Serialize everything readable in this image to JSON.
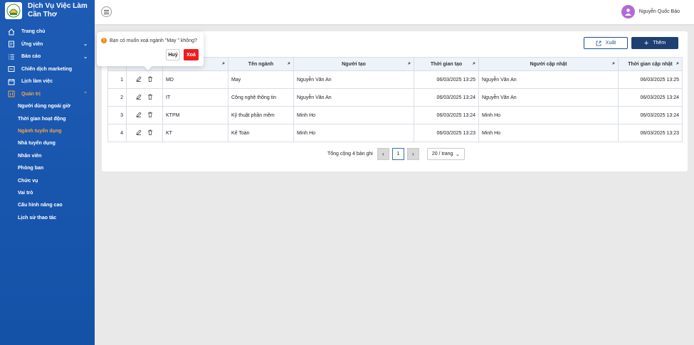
{
  "brand": {
    "title_line1": "Dịch Vụ Việc Làm",
    "title_line2": "Cần Thơ"
  },
  "sidebar": {
    "items": [
      {
        "label": "Trang chủ",
        "icon": "home-icon"
      },
      {
        "label": "Ứng viên",
        "icon": "candidate-icon",
        "expandable": true
      },
      {
        "label": "Báo cáo",
        "icon": "list-icon",
        "expandable": true
      },
      {
        "label": "Chiến dịch marketing",
        "icon": "campaign-icon"
      },
      {
        "label": "Lịch làm việc",
        "icon": "calendar-icon"
      },
      {
        "label": "Quản trị",
        "icon": "admin-icon",
        "expandable": true,
        "expanded": true
      }
    ],
    "sub_items": [
      {
        "label": "Người dùng ngoài giờ"
      },
      {
        "label": "Thời gian hoạt động"
      },
      {
        "label": "Ngành tuyển dụng",
        "active": true
      },
      {
        "label": "Nhà tuyển dụng"
      },
      {
        "label": "Nhân viên"
      },
      {
        "label": "Phòng ban"
      },
      {
        "label": "Chức vụ"
      },
      {
        "label": "Vai trò"
      },
      {
        "label": "Cấu hình nâng cao"
      },
      {
        "label": "Lịch sử thao tác"
      }
    ]
  },
  "header": {
    "user_name": "Nguyễn Quốc Bảo"
  },
  "toolbar": {
    "export_label": "Xuất",
    "add_label": "Thêm"
  },
  "table": {
    "columns": [
      "",
      "",
      "",
      "Tên ngành",
      "Người tạo",
      "Thời gian tạo",
      "Người cập nhật",
      "Thời gian cập nhật"
    ],
    "rows": [
      {
        "stt": "1",
        "code": "MD",
        "name": "May",
        "creator": "Nguyễn Văn An",
        "created": "06/03/2025 13:25",
        "updater": "Nguyễn Văn An",
        "updated": "06/03/2025 13:25"
      },
      {
        "stt": "2",
        "code": "IT",
        "name": "Công nghệ thông tin",
        "creator": "Nguyễn Văn An",
        "created": "06/03/2025 13:24",
        "updater": "Nguyễn Văn An",
        "updated": "06/03/2025 13:24"
      },
      {
        "stt": "3",
        "code": "KTPM",
        "name": "Kỹ thuật phần mềm",
        "creator": "Minh Ho",
        "created": "06/03/2025 13:24",
        "updater": "Minh Ho",
        "updated": "06/03/2025 13:24"
      },
      {
        "stt": "4",
        "code": "KT",
        "name": "Kế Toán",
        "creator": "Minh Ho",
        "created": "06/03/2025 13:23",
        "updater": "Minh Ho",
        "updated": "06/03/2025 13:23"
      }
    ]
  },
  "pagination": {
    "total": "Tổng cộng 4 bản ghi",
    "current": "1",
    "page_size": "20 / trang"
  },
  "popconfirm": {
    "message": "Bạn có muốn xoá ngành \"May \" không?",
    "cancel_label": "Huỷ",
    "ok_label": "Xoá"
  },
  "colors": {
    "sidebar": "#1d5bb5",
    "accent_orange": "#f5a54a",
    "primary_button": "#1e3f72",
    "danger": "#ef1c1c"
  }
}
